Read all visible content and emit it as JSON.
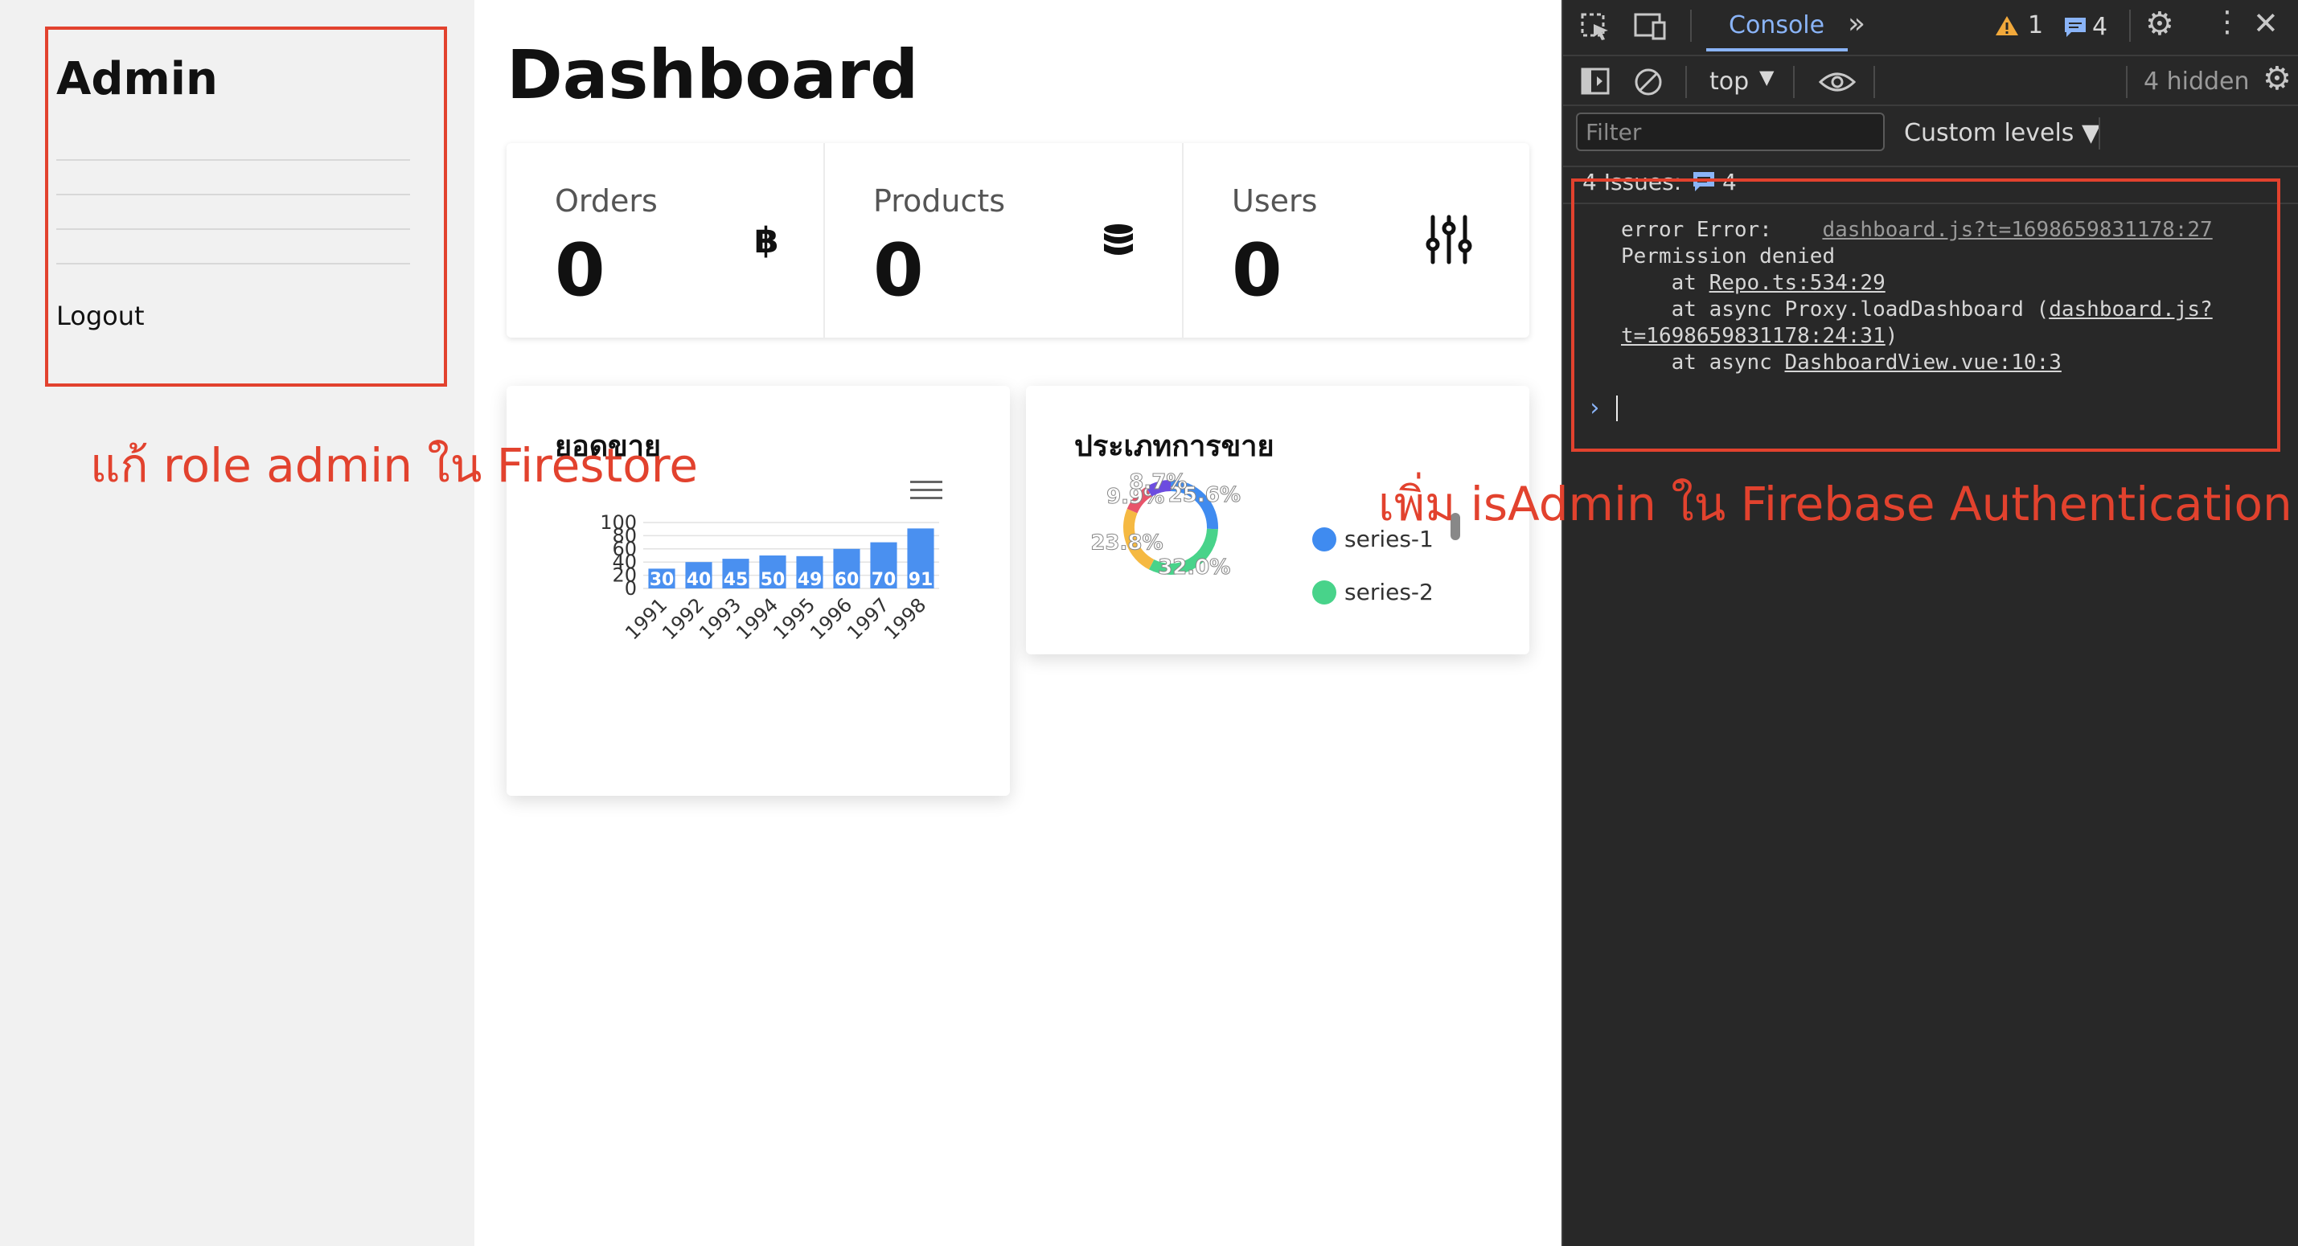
{
  "sidebar": {
    "title": "Admin",
    "logout": "Logout"
  },
  "main": {
    "title": "Dashboard",
    "stats": [
      {
        "label": "Orders",
        "value": "0",
        "icon": "baht-icon",
        "icon_glyph": "฿"
      },
      {
        "label": "Products",
        "value": "0",
        "icon": "database-icon",
        "icon_glyph": ""
      },
      {
        "label": "Users",
        "value": "0",
        "icon": "sliders-icon",
        "icon_glyph": ""
      }
    ],
    "bar_card_title": "ยอดขาย",
    "donut_card_title": "ประเภทการขาย"
  },
  "chart_data": [
    {
      "type": "bar",
      "title": "ยอดขาย",
      "categories": [
        "1991",
        "1992",
        "1993",
        "1994",
        "1995",
        "1996",
        "1997",
        "1998"
      ],
      "values": [
        30,
        40,
        45,
        50,
        49,
        60,
        70,
        91
      ],
      "y_ticks": [
        "0",
        "20",
        "40",
        "60",
        "80",
        "100"
      ],
      "ylim": [
        0,
        100
      ],
      "grid": true,
      "color": "#4a90f0"
    },
    {
      "type": "pie",
      "title": "ประเภทการขาย",
      "style": "donut",
      "slices": [
        {
          "label": "25.6%",
          "value": 25.6,
          "color": "#3f8bf0"
        },
        {
          "label": "32.0%",
          "value": 32.0,
          "color": "#48d38a"
        },
        {
          "label": "23.8%",
          "value": 23.8,
          "color": "#f5b942"
        },
        {
          "label": "9.9%",
          "value": 9.9,
          "color": "#e8546a"
        },
        {
          "label": "8.7%",
          "value": 8.7,
          "color": "#6c4ce0"
        }
      ],
      "legend": [
        "series-1",
        "series-2"
      ],
      "legend_placement": "right"
    }
  ],
  "devtools": {
    "tab": "Console",
    "warnings_count": "1",
    "messages_count": "4",
    "context": "top",
    "hidden": "4 hidden",
    "filter_placeholder": "Filter",
    "levels": "Custom levels ▼",
    "issues_label": "4 Issues:",
    "issues_count": "4",
    "log": {
      "line1": "error Error:    ",
      "link1": "dashboard.js?t=1698659831178:27",
      "line2": "Permission denied",
      "line3": "    at ",
      "link3": "Repo.ts:534:29",
      "line4": "    at async Proxy.loadDashboard (",
      "link4a": "dashboard.js?",
      "link4b": "t=1698659831178:24:31",
      "line4end": ")",
      "line5": "    at async ",
      "link5": "DashboardView.vue:10:3"
    }
  },
  "annotations": {
    "left": "แก้ role admin ใน Firestore",
    "right": "เพิ่ม isAdmin ใน Firebase Authentication",
    "color": "#e2422e"
  }
}
